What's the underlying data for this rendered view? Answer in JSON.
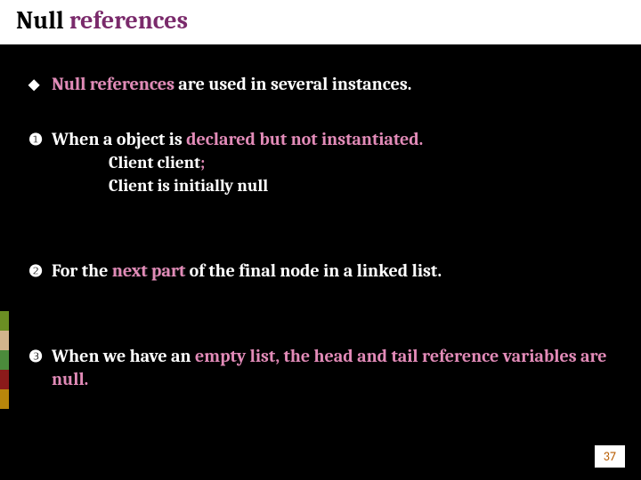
{
  "header": {
    "title_prefix": "Null ",
    "title_highlight": "references"
  },
  "bullets": {
    "diamond": "◆",
    "one": "❶",
    "two": "❷",
    "three": "❸"
  },
  "intro": {
    "hl": "Null references",
    "rest": " are used in several instances."
  },
  "item1": {
    "pre": "When a object is ",
    "hl": "declared  but not instantiated.",
    "sub1a": "Client client",
    "sub1b": ";",
    "sub2": "Client is initially null"
  },
  "item2": {
    "pre": "For the ",
    "hl": "next part",
    "post": " of the final node in a linked list."
  },
  "item3": {
    "pre": "When we have an ",
    "hl": "empty list, the head and tail reference variables are null."
  },
  "page": "37"
}
